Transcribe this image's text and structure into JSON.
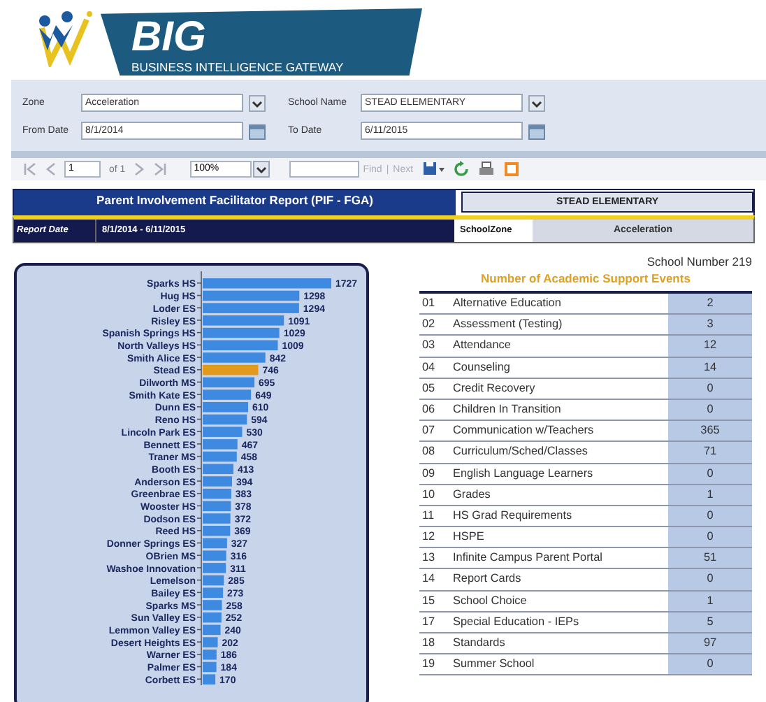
{
  "header": {
    "logo_title": "BIG",
    "logo_subtitle": "BUSINESS INTELLIGENCE GATEWAY"
  },
  "parameters": [
    {
      "label": "Zone",
      "value": "Acceleration",
      "kind": "dropdown"
    },
    {
      "label": "School Name",
      "value": "STEAD ELEMENTARY",
      "kind": "dropdown"
    },
    {
      "label": "From Date",
      "value": "8/1/2014",
      "kind": "date"
    },
    {
      "label": "To Date",
      "value": "6/11/2015",
      "kind": "date"
    }
  ],
  "toolbar": {
    "page": "1",
    "page_count": "of 1",
    "zoom": "100%",
    "find": "Find",
    "separator": "|",
    "next": "Next"
  },
  "report": {
    "title": "Parent Involvement Facilitator Report (PIF - FGA)",
    "school": "STEAD ELEMENTARY",
    "date_label": "Report Date",
    "date_range": "8/1/2014 - 6/11/2015",
    "zone_label": "SchoolZone",
    "zone": "Acceleration",
    "school_number": "School Number 219"
  },
  "chart": {
    "chart_data": {
      "type": "bar",
      "orientation": "horizontal",
      "stacked": true,
      "data_labels": true,
      "categories": [
        "Sparks HS",
        "Hug HS",
        "Loder ES",
        "Risley ES",
        "Spanish Springs HS",
        "North Valleys HS",
        "Smith Alice ES",
        "Stead ES",
        "Dilworth MS",
        "Smith Kate ES",
        "Dunn ES",
        "Reno HS",
        "Lincoln Park ES",
        "Bennett ES",
        "Traner MS",
        "Booth ES",
        "Anderson ES",
        "Greenbrae ES",
        "Wooster HS",
        "Dodson ES",
        "Reed HS",
        "Donner Springs ES",
        "OBrien MS",
        "Washoe Innovation",
        "Lemelson",
        "Bailey ES",
        "Sparks MS",
        "Sun Valley ES",
        "Lemmon Valley ES",
        "Desert Heights ES",
        "Warner ES",
        "Palmer ES",
        "Corbett ES"
      ],
      "series": [
        {
          "color": "#3d8ae0",
          "values": [
            1727,
            1298,
            1294,
            1091,
            1029,
            1009,
            842,
            null,
            695,
            649,
            610,
            594,
            530,
            467,
            458,
            413,
            394,
            383,
            378,
            372,
            369,
            327,
            316,
            311,
            285,
            273,
            258,
            252,
            240,
            202,
            186,
            184,
            170
          ]
        },
        {
          "color": "#e29a1c",
          "values": [
            null,
            null,
            null,
            null,
            null,
            null,
            null,
            746,
            null,
            null,
            null,
            null,
            null,
            null,
            null,
            null,
            null,
            null,
            null,
            null,
            null,
            null,
            null,
            null,
            null,
            null,
            null,
            null,
            null,
            null,
            null,
            null,
            null
          ]
        }
      ]
    }
  },
  "events": {
    "title": "Number of Academic Support Events",
    "rows": [
      {
        "code": "01",
        "name": "Alternative Education",
        "count": "2"
      },
      {
        "code": "02",
        "name": "Assessment (Testing)",
        "count": "3"
      },
      {
        "code": "03",
        "name": "Attendance",
        "count": "12"
      },
      {
        "code": "04",
        "name": "Counseling",
        "count": "14"
      },
      {
        "code": "05",
        "name": "Credit Recovery",
        "count": "0"
      },
      {
        "code": "06",
        "name": "Children In Transition",
        "count": "0"
      },
      {
        "code": "07",
        "name": "Communication w/Teachers",
        "count": "365"
      },
      {
        "code": "08",
        "name": "Curriculum/Sched/Classes",
        "count": "71"
      },
      {
        "code": "09",
        "name": "English Language Learners",
        "count": "0"
      },
      {
        "code": "10",
        "name": "Grades",
        "count": "1"
      },
      {
        "code": "11",
        "name": "HS Grad Requirements",
        "count": "0"
      },
      {
        "code": "12",
        "name": "HSPE",
        "count": "0"
      },
      {
        "code": "13",
        "name": "Infinite Campus Parent Portal",
        "count": "51"
      },
      {
        "code": "14",
        "name": "Report Cards",
        "count": "0"
      },
      {
        "code": "15",
        "name": "School Choice",
        "count": "1"
      },
      {
        "code": "17",
        "name": "Special Education - IEPs",
        "count": "5"
      },
      {
        "code": "18",
        "name": "Standards",
        "count": "97"
      },
      {
        "code": "19",
        "name": "Summer School",
        "count": "0"
      }
    ]
  }
}
